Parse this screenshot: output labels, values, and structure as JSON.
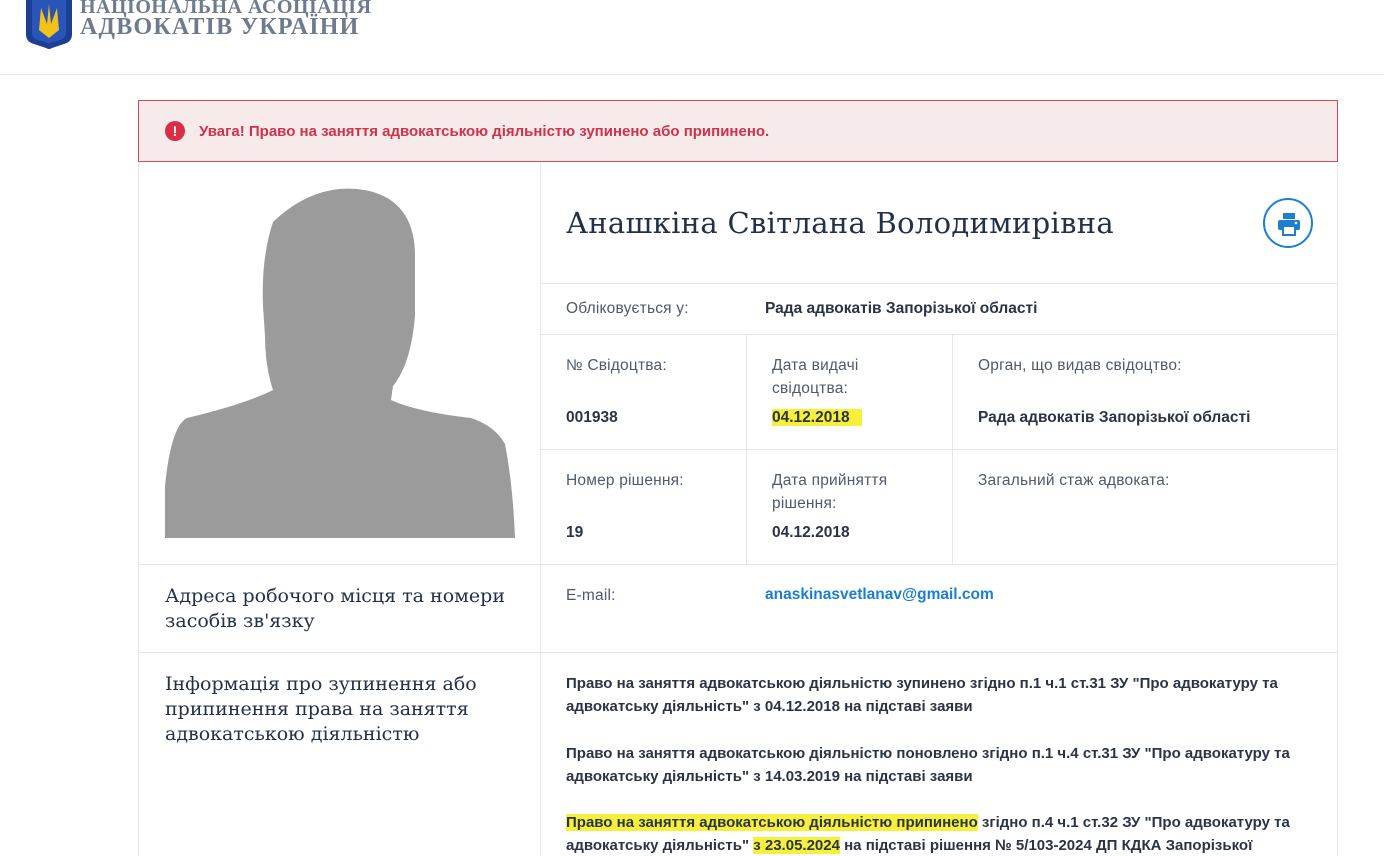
{
  "header": {
    "logo_line1": "НАЦІОНАЛЬНА АСОЦІАЦІЯ",
    "logo_line2": "АДВОКАТІВ УКРАЇНИ",
    "colors": {
      "emblem_blue": "#1c3f94",
      "emblem_gold": "#f2c21b",
      "logo_text": "#6f7a8c"
    }
  },
  "alert": {
    "icon": "exclamation-circle-icon",
    "text": "Увага! Право на заняття адвокатською діяльністю зупинено або припинено.",
    "colors": {
      "text": "#d0324a",
      "border": "#d94b5b",
      "background": "#f7eaea"
    }
  },
  "profile": {
    "name": "Анашкіна Світлана Володимирівна",
    "print_icon": "printer-icon",
    "registered_label": "Обліковується у:",
    "registered_value": "Рада адвокатів Запорізької області",
    "certificate_no_label": "№ Свідоцтва:",
    "certificate_no_value": "001938",
    "certificate_date_label": "Дата видачі свідоцтва:",
    "certificate_date_value": "04.12.2018",
    "issuer_label": "Орган, що видав свідоцтво:",
    "issuer_value": "Рада адвокатів Запорізької області",
    "decision_no_label": "Номер рішення:",
    "decision_no_value": "19",
    "decision_date_label": "Дата прийняття рішення:",
    "decision_date_value": "04.12.2018",
    "experience_label": "Загальний стаж адвоката:"
  },
  "contacts": {
    "title": "Адреса робочого місця та номери засобів зв'язку",
    "email_label": "E-mail:",
    "email_value": "anaskinasvetlanav@gmail.com"
  },
  "suspension": {
    "title": "Інформація про зупинення або припинення права на заняття адвокатською діяльністю",
    "paragraph1": "Право на заняття адвокатською діяльністю зупинено згідно п.1 ч.1 ст.31 ЗУ \"Про адвокатуру та адвокатську діяльність\" з 04.12.2018 на підставі заяви",
    "paragraph2": "Право на заняття адвокатською діяльністю поновлено згідно п.1 ч.4 ст.31 ЗУ \"Про адвокатуру та адвокатську діяльність\" з 14.03.2019 на підставі заяви",
    "paragraph3_hl1": "Право на заняття адвокатською діяльністю припинено",
    "paragraph3_part1": " згідно п.4 ч.1 ст.32 ЗУ \"Про адвокатуру та адвокатську діяльність\" ",
    "paragraph3_hl2": "з 23.05.2024",
    "paragraph3_part2": " на підставі рішення № 5/103-2024 ДП КДКА Запорізької"
  },
  "colors": {
    "highlight": "#f7f03a",
    "link": "#1a7fd0",
    "accent": "#1e7fd0",
    "photo_gray": "#9b9b9b"
  }
}
